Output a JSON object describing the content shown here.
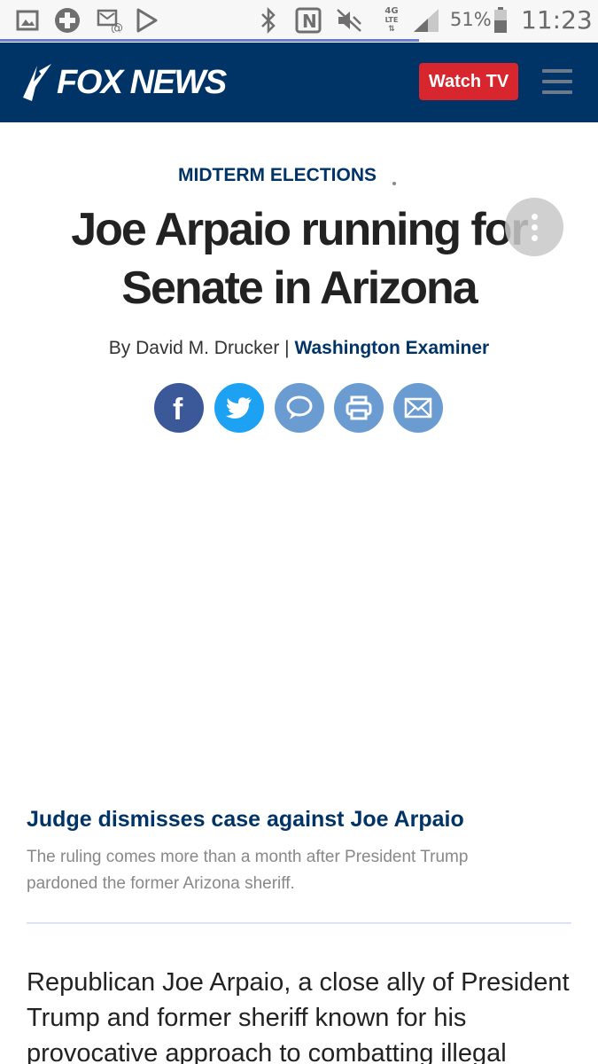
{
  "status_bar": {
    "battery_percent": "51%",
    "time": "11:23",
    "network": "4G LTE",
    "icons": [
      "gallery-icon",
      "plus-circle-icon",
      "email-notification-icon",
      "play-store-icon",
      "bluetooth-icon",
      "nfc-icon",
      "mute-icon",
      "network-4g-icon",
      "signal-icon",
      "battery-icon"
    ],
    "page_load_progress": 0.7
  },
  "header": {
    "logo_text": "FOX NEWS",
    "watch_button": "Watch TV",
    "colors": {
      "background": "#003366",
      "button": "#d7262e"
    }
  },
  "article": {
    "category": "MIDTERM ELECTIONS",
    "headline_line1": "Joe Arpaio running for",
    "headline_line2": "Senate in Arizona",
    "byline_prefix": "By David M. Drucker",
    "byline_separator": " | ",
    "publication": "Washington Examiner",
    "share_buttons": [
      "facebook-icon",
      "twitter-icon",
      "comment-icon",
      "print-icon",
      "email-icon"
    ]
  },
  "related": {
    "title": "Judge dismisses case against Joe Arpaio",
    "description": "The ruling comes more than a month after President Trump pardoned the former Arizona sheriff."
  },
  "body": {
    "paragraph_start": "Republican Joe Arpaio, a close ally of President Trump and former sheriff known for his provocative approach to combatting illegal"
  }
}
